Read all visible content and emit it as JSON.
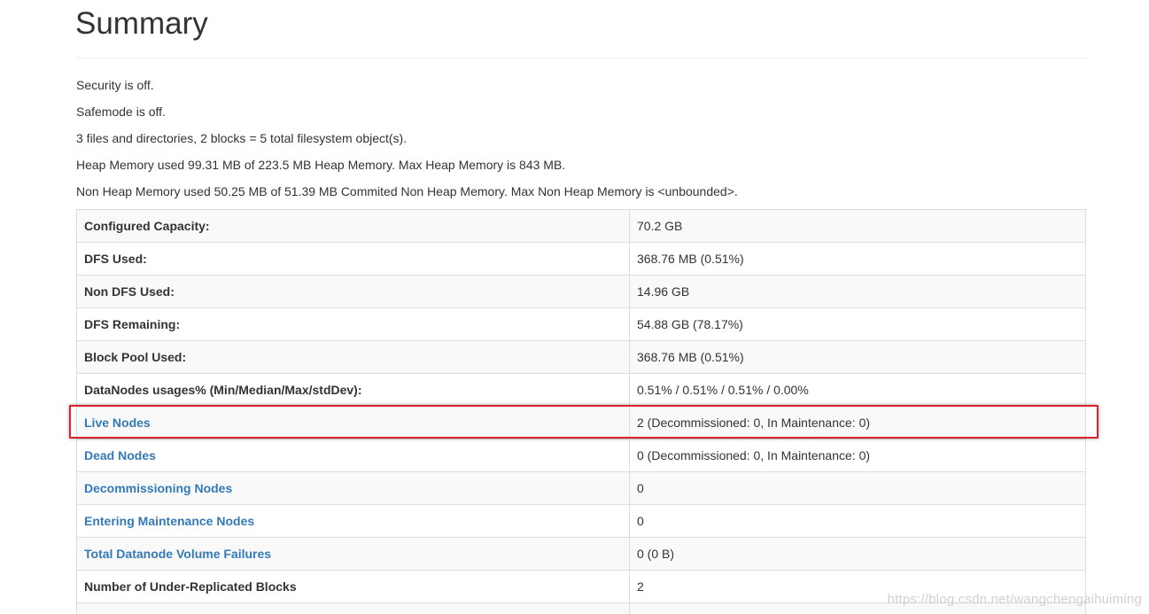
{
  "header": {
    "title": "Summary"
  },
  "info_lines": [
    "Security is off.",
    "Safemode is off.",
    "3 files and directories, 2 blocks = 5 total filesystem object(s).",
    "Heap Memory used 99.31 MB of 223.5 MB Heap Memory. Max Heap Memory is 843 MB.",
    "Non Heap Memory used 50.25 MB of 51.39 MB Commited Non Heap Memory. Max Non Heap Memory is <unbounded>."
  ],
  "stats_table": [
    {
      "label": "Configured Capacity:",
      "value": "70.2 GB"
    },
    {
      "label": "DFS Used:",
      "value": "368.76 MB (0.51%)"
    },
    {
      "label": "Non DFS Used:",
      "value": "14.96 GB"
    },
    {
      "label": "DFS Remaining:",
      "value": "54.88 GB (78.17%)"
    },
    {
      "label": "Block Pool Used:",
      "value": "368.76 MB (0.51%)"
    },
    {
      "label": "DataNodes usages% (Min/Median/Max/stdDev):",
      "value": "0.51% / 0.51% / 0.51% / 0.00%"
    },
    {
      "label": "Live Nodes",
      "value": "2 (Decommissioned: 0, In Maintenance: 0)"
    },
    {
      "label": "Dead Nodes",
      "value": "0 (Decommissioned: 0, In Maintenance: 0)"
    },
    {
      "label": "Decommissioning Nodes",
      "value": "0"
    },
    {
      "label": "Entering Maintenance Nodes",
      "value": "0"
    },
    {
      "label": "Total Datanode Volume Failures",
      "value": "0 (0 B)"
    },
    {
      "label": "Number of Under-Replicated Blocks",
      "value": "2"
    },
    {
      "label": "",
      "value": ""
    }
  ],
  "colors": {
    "link": "#337ab7",
    "highlight_border": "#d9232b",
    "text": "#333333"
  },
  "watermark": "https://blog.csdn.net/wangchengaihuiming"
}
